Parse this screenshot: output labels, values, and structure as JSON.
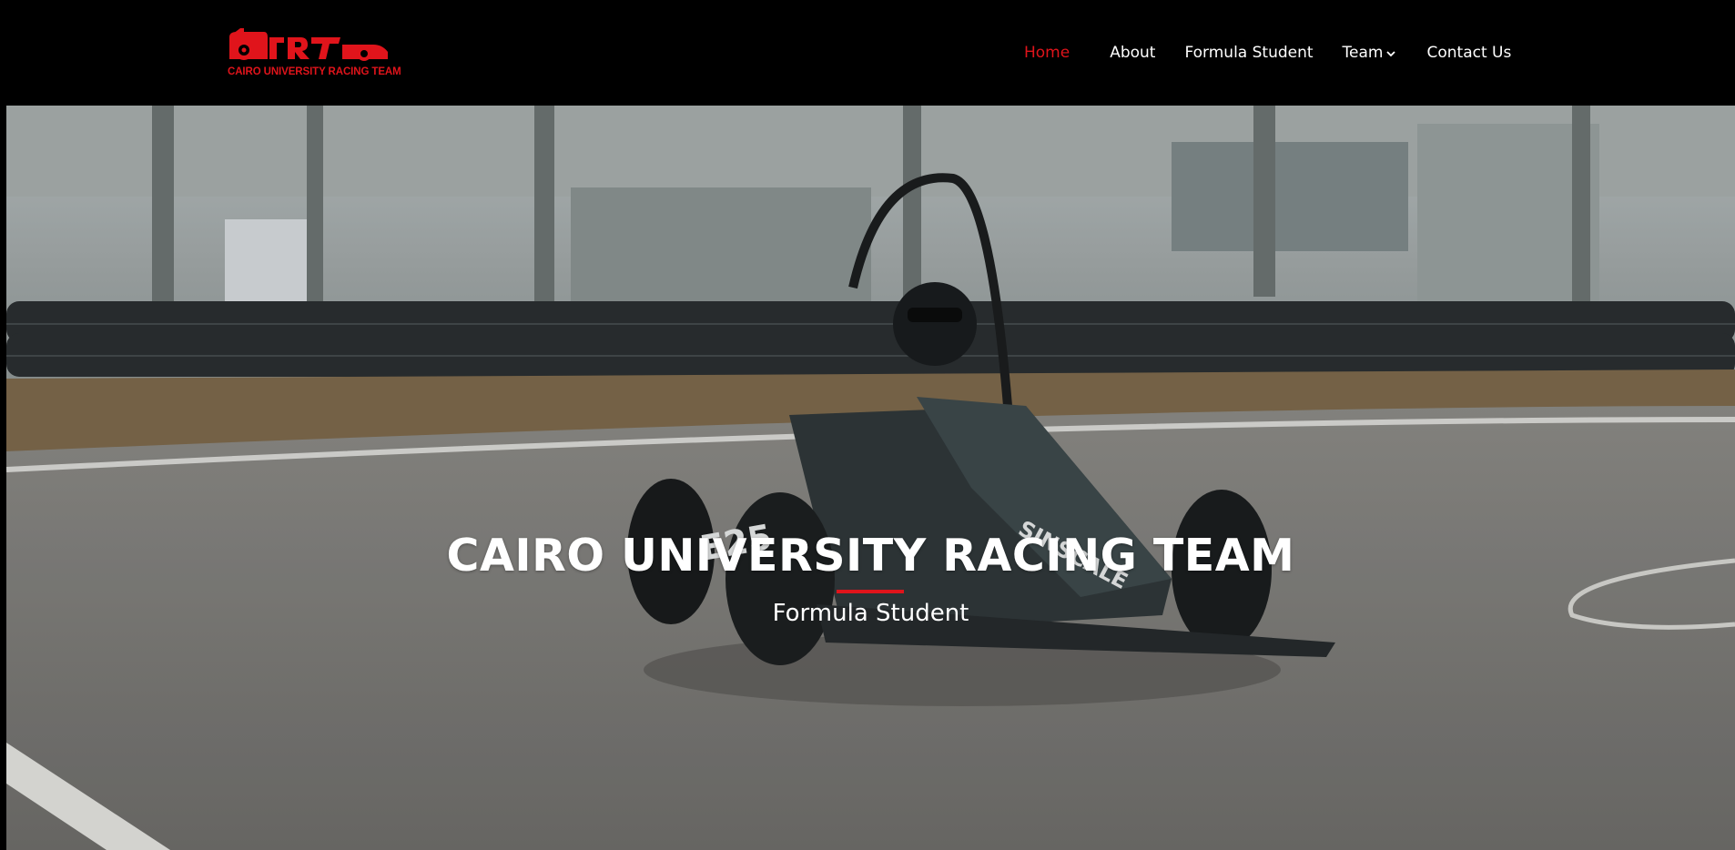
{
  "brand": {
    "caption": "CAIRO UNIVERSITY RACING TEAM",
    "logo_letters": "CURT",
    "accent_color": "#e0141b"
  },
  "nav": {
    "items": [
      {
        "label": "Home",
        "active": true
      },
      {
        "label": "About",
        "active": false
      },
      {
        "label": "Formula Student",
        "active": false
      },
      {
        "label": "Team",
        "active": false,
        "has_dropdown": true,
        "icon": "chevron-down-icon"
      },
      {
        "label": "Contact Us",
        "active": false
      }
    ]
  },
  "hero": {
    "title": "CAIRO UNIVERSITY RACING TEAM",
    "subtitle": "Formula Student",
    "background": "photo of a black formula student race car driving on a track with tire barriers",
    "car_number": "E25",
    "car_sponsor": "SINSCALE"
  }
}
